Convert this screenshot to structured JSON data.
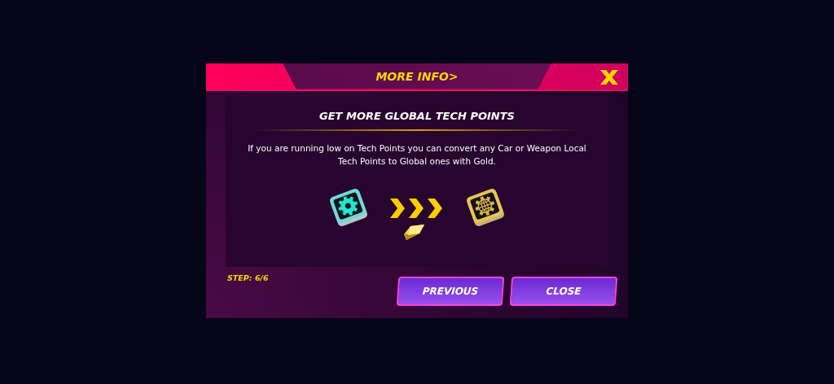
{
  "dialog": {
    "title": "MORE INFO>",
    "heading": "GET MORE GLOBAL TECH POINTS",
    "description": "If you are running low on Tech Points you can convert any Car or Weapon Local Tech Points to Global ones with Gold.",
    "step": "STEP: 6/6",
    "buttons": [
      {
        "label": "PREVIOUS"
      },
      {
        "label": "CLOSE"
      }
    ]
  }
}
